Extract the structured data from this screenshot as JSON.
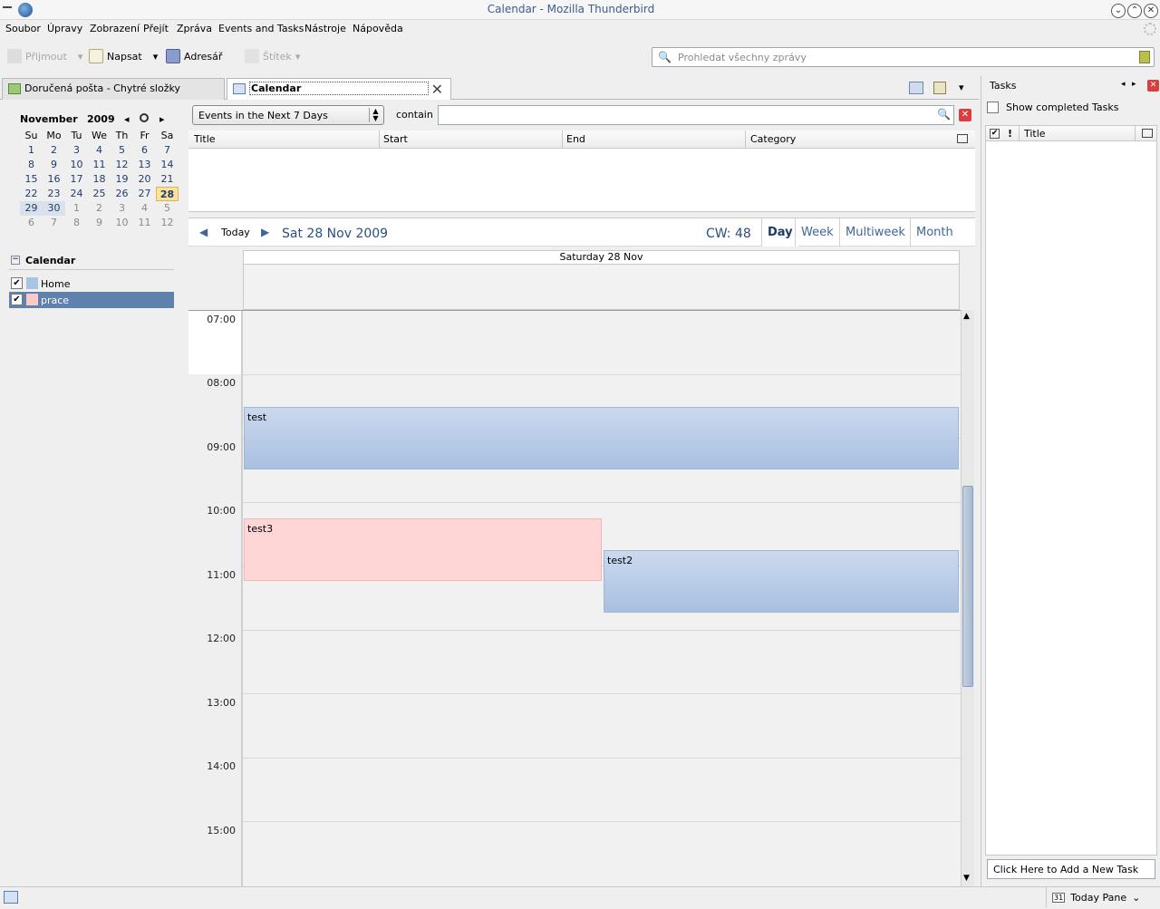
{
  "window": {
    "title": "Calendar - Mozilla Thunderbird"
  },
  "menu": [
    "Soubor",
    "Úpravy",
    "Zobrazení",
    "Přejít",
    "Zpráva",
    "Events and Tasks",
    "Nástroje",
    "Nápověda"
  ],
  "toolbar": {
    "receive": "Přijmout",
    "compose": "Napsat",
    "addressbook": "Adresář",
    "tag": "Štítek"
  },
  "search": {
    "placeholder": "Prohledat všechny zprávy"
  },
  "tabs": [
    {
      "label": "Doručená pošta - Chytré složky"
    },
    {
      "label": "Calendar"
    }
  ],
  "minimonth": {
    "month": "November",
    "year": "2009",
    "weekdays": [
      "Su",
      "Mo",
      "Tu",
      "We",
      "Th",
      "Fr",
      "Sa"
    ],
    "weeks": [
      [
        "1",
        "2",
        "3",
        "4",
        "5",
        "6",
        "7"
      ],
      [
        "8",
        "9",
        "10",
        "11",
        "12",
        "13",
        "14"
      ],
      [
        "15",
        "16",
        "17",
        "18",
        "19",
        "20",
        "21"
      ],
      [
        "22",
        "23",
        "24",
        "25",
        "26",
        "27",
        "28"
      ],
      [
        "29",
        "30",
        "1",
        "2",
        "3",
        "4",
        "5"
      ],
      [
        "6",
        "7",
        "8",
        "9",
        "10",
        "11",
        "12"
      ]
    ],
    "today": "28"
  },
  "calendars": {
    "heading": "Calendar",
    "items": [
      {
        "name": "Home",
        "color": "#aac4e6",
        "checked": true
      },
      {
        "name": "prace",
        "color": "#ffc8c8",
        "checked": true
      }
    ]
  },
  "filter": {
    "selected": "Events in the Next 7 Days",
    "contain_label": "contain",
    "value": ""
  },
  "list_columns": [
    "Title",
    "Start",
    "End",
    "Category"
  ],
  "dayview": {
    "today_label": "Today",
    "date_label": "Sat 28 Nov 2009",
    "cw": "CW: 48",
    "views": [
      "Day",
      "Week",
      "Multiweek",
      "Month"
    ],
    "active_view": "Day",
    "column_header": "Saturday 28 Nov",
    "hours": [
      "07:00",
      "08:00",
      "09:00",
      "10:00",
      "11:00",
      "12:00",
      "13:00",
      "14:00",
      "15:00"
    ],
    "events": [
      {
        "title": "test",
        "calendar": "Home"
      },
      {
        "title": "test3",
        "calendar": "prace"
      },
      {
        "title": "test2",
        "calendar": "Home"
      }
    ]
  },
  "tasks": {
    "title": "Tasks",
    "show_completed": "Show completed Tasks",
    "column_title": "Title",
    "new_task_placeholder": "Click Here to Add a New Task"
  },
  "statusbar": {
    "today_pane": "Today Pane",
    "today_icon_text": "31"
  }
}
